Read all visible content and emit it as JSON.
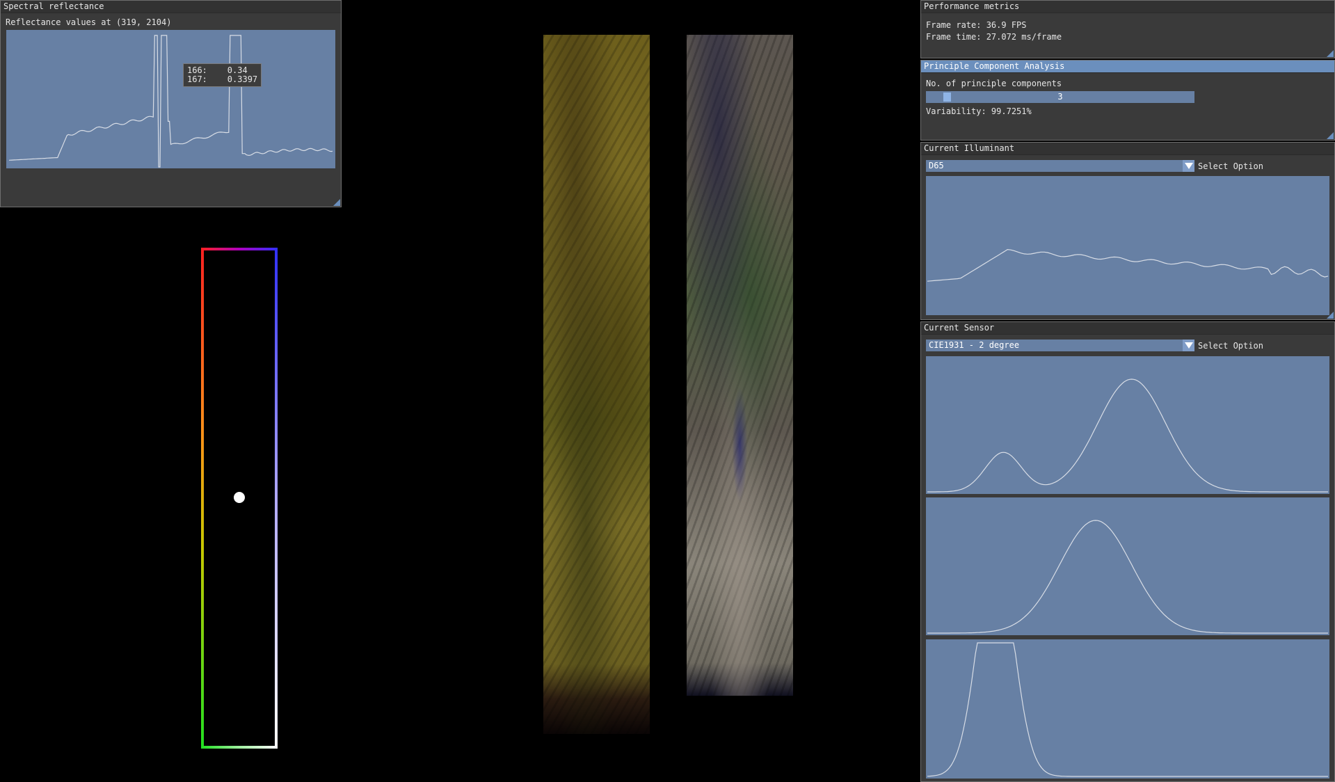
{
  "spectral": {
    "title": "Spectral reflectance",
    "label": "Reflectance values at (319, 2104)",
    "tooltip": [
      {
        "index": "166:",
        "value": "0.34"
      },
      {
        "index": "167:",
        "value": "0.3397"
      }
    ]
  },
  "performance": {
    "title": "Performance metrics",
    "frame_rate": "Frame rate: 36.9 FPS",
    "frame_time": "Frame time: 27.072 ms/frame"
  },
  "pca": {
    "title": "Principle Component Analysis",
    "components_label": "No. of principle components",
    "components_value": "3",
    "variability": "Variability: 99.7251%"
  },
  "illuminant": {
    "title": "Current Illuminant",
    "selected": "D65",
    "select_label": "Select Option"
  },
  "sensor": {
    "title": "Current Sensor",
    "selected": "CIE1931 - 2 degree",
    "select_label": "Select Option"
  },
  "colors": {
    "panel_bg": "#3a3a3a",
    "plot_bg": "#6780a4",
    "accent": "#6b8fbd",
    "line": "#d8dde6"
  }
}
